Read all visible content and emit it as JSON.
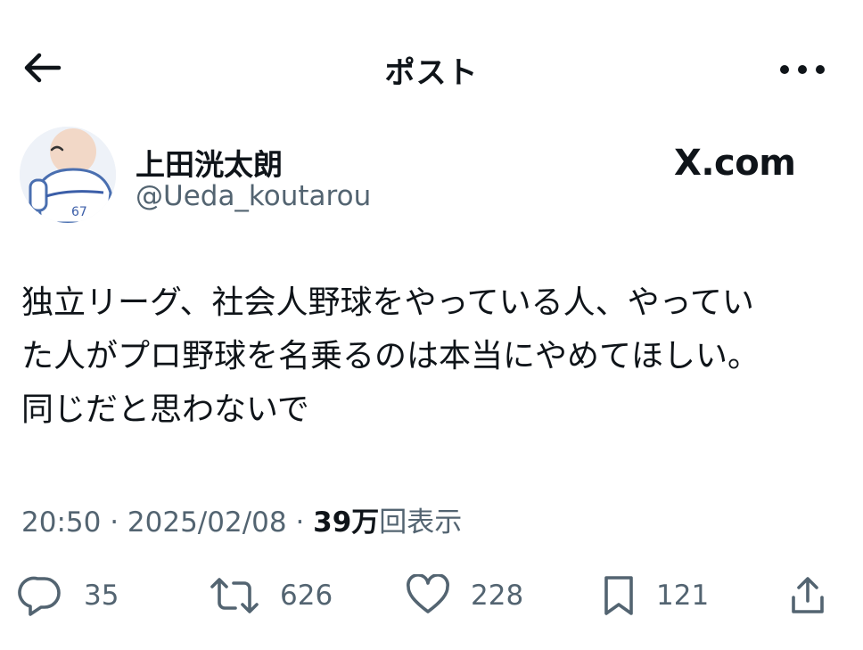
{
  "header": {
    "title": "ポスト",
    "back_icon": "arrow-left-icon",
    "more_icon": "more-horizontal-icon"
  },
  "author": {
    "display_name": "上田洸太朗",
    "handle": "@Ueda_koutarou",
    "watermark": "X.com"
  },
  "post": {
    "text": "独立リーグ、社会人野球をやっている人、やってい\nた人がプロ野球を名乗るのは本当にやめてほしい。\n同じだと思わないで"
  },
  "meta": {
    "time": "20:50",
    "date": "2025/02/08",
    "separator": " · ",
    "views_count": "39万",
    "views_label": "回表示"
  },
  "actions": {
    "replies": "35",
    "reposts": "626",
    "likes": "228",
    "bookmarks": "121"
  },
  "colors": {
    "text": "#0f1419",
    "secondary": "#536471",
    "background": "#ffffff"
  }
}
